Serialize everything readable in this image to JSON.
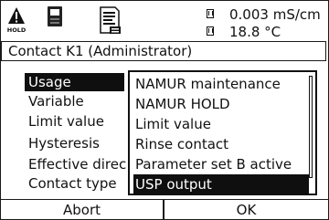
{
  "status": {
    "hold_badge": "HOLD",
    "hold_icon": "warning-hold-icon",
    "sensor_icon": "sensor-icon",
    "doc_icon": "documentation-icon",
    "measure1": "0.003 mS/cm",
    "measure2": "18.8 °C"
  },
  "title": "Contact K1 (Administrator)",
  "settings": {
    "rows": [
      {
        "label": "Usage"
      },
      {
        "label": "Variable"
      },
      {
        "label": "Limit value"
      },
      {
        "label": "Hysteresis"
      },
      {
        "label": "Effective direc"
      },
      {
        "label": "Contact type"
      }
    ]
  },
  "dropdown": {
    "options": [
      {
        "label": "NAMUR maintenance"
      },
      {
        "label": "NAMUR HOLD"
      },
      {
        "label": "Limit value"
      },
      {
        "label": "Rinse contact"
      },
      {
        "label": "Parameter set B active"
      },
      {
        "label": "USP output"
      }
    ],
    "selected": "USP output"
  },
  "softkeys": {
    "left": "Abort",
    "right": "OK"
  }
}
